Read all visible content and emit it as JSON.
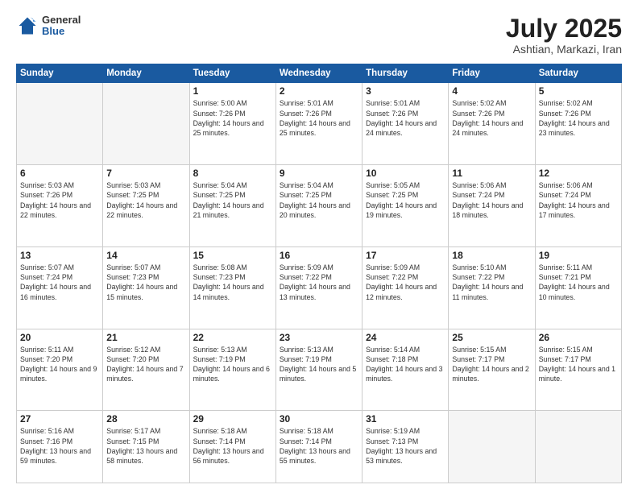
{
  "header": {
    "logo": {
      "general": "General",
      "blue": "Blue"
    },
    "title": "July 2025",
    "location": "Ashtian, Markazi, Iran"
  },
  "calendar": {
    "days_of_week": [
      "Sunday",
      "Monday",
      "Tuesday",
      "Wednesday",
      "Thursday",
      "Friday",
      "Saturday"
    ],
    "weeks": [
      [
        {
          "day": "",
          "empty": true
        },
        {
          "day": "",
          "empty": true
        },
        {
          "day": "1",
          "sunrise": "Sunrise: 5:00 AM",
          "sunset": "Sunset: 7:26 PM",
          "daylight": "Daylight: 14 hours and 25 minutes."
        },
        {
          "day": "2",
          "sunrise": "Sunrise: 5:01 AM",
          "sunset": "Sunset: 7:26 PM",
          "daylight": "Daylight: 14 hours and 25 minutes."
        },
        {
          "day": "3",
          "sunrise": "Sunrise: 5:01 AM",
          "sunset": "Sunset: 7:26 PM",
          "daylight": "Daylight: 14 hours and 24 minutes."
        },
        {
          "day": "4",
          "sunrise": "Sunrise: 5:02 AM",
          "sunset": "Sunset: 7:26 PM",
          "daylight": "Daylight: 14 hours and 24 minutes."
        },
        {
          "day": "5",
          "sunrise": "Sunrise: 5:02 AM",
          "sunset": "Sunset: 7:26 PM",
          "daylight": "Daylight: 14 hours and 23 minutes."
        }
      ],
      [
        {
          "day": "6",
          "sunrise": "Sunrise: 5:03 AM",
          "sunset": "Sunset: 7:26 PM",
          "daylight": "Daylight: 14 hours and 22 minutes."
        },
        {
          "day": "7",
          "sunrise": "Sunrise: 5:03 AM",
          "sunset": "Sunset: 7:25 PM",
          "daylight": "Daylight: 14 hours and 22 minutes."
        },
        {
          "day": "8",
          "sunrise": "Sunrise: 5:04 AM",
          "sunset": "Sunset: 7:25 PM",
          "daylight": "Daylight: 14 hours and 21 minutes."
        },
        {
          "day": "9",
          "sunrise": "Sunrise: 5:04 AM",
          "sunset": "Sunset: 7:25 PM",
          "daylight": "Daylight: 14 hours and 20 minutes."
        },
        {
          "day": "10",
          "sunrise": "Sunrise: 5:05 AM",
          "sunset": "Sunset: 7:25 PM",
          "daylight": "Daylight: 14 hours and 19 minutes."
        },
        {
          "day": "11",
          "sunrise": "Sunrise: 5:06 AM",
          "sunset": "Sunset: 7:24 PM",
          "daylight": "Daylight: 14 hours and 18 minutes."
        },
        {
          "day": "12",
          "sunrise": "Sunrise: 5:06 AM",
          "sunset": "Sunset: 7:24 PM",
          "daylight": "Daylight: 14 hours and 17 minutes."
        }
      ],
      [
        {
          "day": "13",
          "sunrise": "Sunrise: 5:07 AM",
          "sunset": "Sunset: 7:24 PM",
          "daylight": "Daylight: 14 hours and 16 minutes."
        },
        {
          "day": "14",
          "sunrise": "Sunrise: 5:07 AM",
          "sunset": "Sunset: 7:23 PM",
          "daylight": "Daylight: 14 hours and 15 minutes."
        },
        {
          "day": "15",
          "sunrise": "Sunrise: 5:08 AM",
          "sunset": "Sunset: 7:23 PM",
          "daylight": "Daylight: 14 hours and 14 minutes."
        },
        {
          "day": "16",
          "sunrise": "Sunrise: 5:09 AM",
          "sunset": "Sunset: 7:22 PM",
          "daylight": "Daylight: 14 hours and 13 minutes."
        },
        {
          "day": "17",
          "sunrise": "Sunrise: 5:09 AM",
          "sunset": "Sunset: 7:22 PM",
          "daylight": "Daylight: 14 hours and 12 minutes."
        },
        {
          "day": "18",
          "sunrise": "Sunrise: 5:10 AM",
          "sunset": "Sunset: 7:22 PM",
          "daylight": "Daylight: 14 hours and 11 minutes."
        },
        {
          "day": "19",
          "sunrise": "Sunrise: 5:11 AM",
          "sunset": "Sunset: 7:21 PM",
          "daylight": "Daylight: 14 hours and 10 minutes."
        }
      ],
      [
        {
          "day": "20",
          "sunrise": "Sunrise: 5:11 AM",
          "sunset": "Sunset: 7:20 PM",
          "daylight": "Daylight: 14 hours and 9 minutes."
        },
        {
          "day": "21",
          "sunrise": "Sunrise: 5:12 AM",
          "sunset": "Sunset: 7:20 PM",
          "daylight": "Daylight: 14 hours and 7 minutes."
        },
        {
          "day": "22",
          "sunrise": "Sunrise: 5:13 AM",
          "sunset": "Sunset: 7:19 PM",
          "daylight": "Daylight: 14 hours and 6 minutes."
        },
        {
          "day": "23",
          "sunrise": "Sunrise: 5:13 AM",
          "sunset": "Sunset: 7:19 PM",
          "daylight": "Daylight: 14 hours and 5 minutes."
        },
        {
          "day": "24",
          "sunrise": "Sunrise: 5:14 AM",
          "sunset": "Sunset: 7:18 PM",
          "daylight": "Daylight: 14 hours and 3 minutes."
        },
        {
          "day": "25",
          "sunrise": "Sunrise: 5:15 AM",
          "sunset": "Sunset: 7:17 PM",
          "daylight": "Daylight: 14 hours and 2 minutes."
        },
        {
          "day": "26",
          "sunrise": "Sunrise: 5:15 AM",
          "sunset": "Sunset: 7:17 PM",
          "daylight": "Daylight: 14 hours and 1 minute."
        }
      ],
      [
        {
          "day": "27",
          "sunrise": "Sunrise: 5:16 AM",
          "sunset": "Sunset: 7:16 PM",
          "daylight": "Daylight: 13 hours and 59 minutes."
        },
        {
          "day": "28",
          "sunrise": "Sunrise: 5:17 AM",
          "sunset": "Sunset: 7:15 PM",
          "daylight": "Daylight: 13 hours and 58 minutes."
        },
        {
          "day": "29",
          "sunrise": "Sunrise: 5:18 AM",
          "sunset": "Sunset: 7:14 PM",
          "daylight": "Daylight: 13 hours and 56 minutes."
        },
        {
          "day": "30",
          "sunrise": "Sunrise: 5:18 AM",
          "sunset": "Sunset: 7:14 PM",
          "daylight": "Daylight: 13 hours and 55 minutes."
        },
        {
          "day": "31",
          "sunrise": "Sunrise: 5:19 AM",
          "sunset": "Sunset: 7:13 PM",
          "daylight": "Daylight: 13 hours and 53 minutes."
        },
        {
          "day": "",
          "empty": true
        },
        {
          "day": "",
          "empty": true
        }
      ]
    ]
  }
}
